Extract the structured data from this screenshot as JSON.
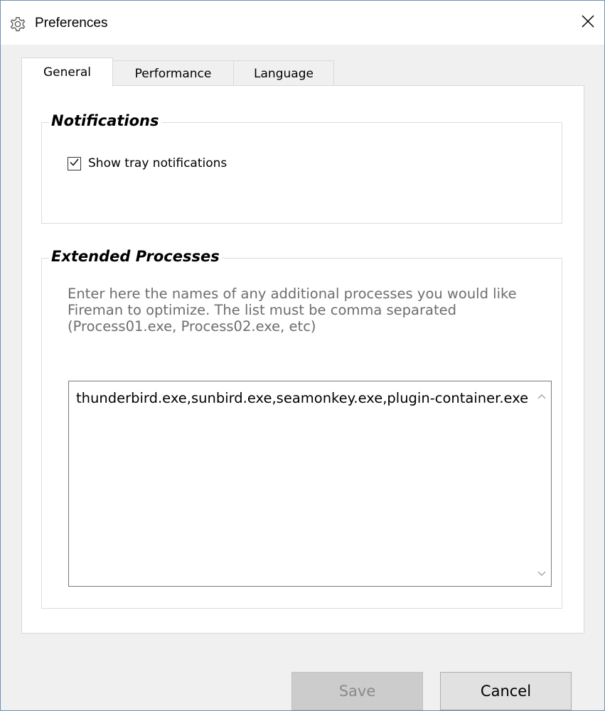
{
  "window": {
    "title": "Preferences",
    "title_icon": "gear-icon",
    "close_icon": "close-icon"
  },
  "tabs": [
    {
      "label": "General",
      "active": true
    },
    {
      "label": "Performance",
      "active": false
    },
    {
      "label": "Language",
      "active": false
    }
  ],
  "notifications": {
    "legend": "Notifications",
    "show_tray": {
      "label": "Show tray notifications",
      "checked": true
    }
  },
  "extended_processes": {
    "legend": "Extended Processes",
    "description": "Enter here the names of any additional processes you would like Fireman to optimize. The list must be comma separated (Process01.exe, Process02.exe, etc)",
    "value": "thunderbird.exe,sunbird.exe,seamonkey.exe,plugin-container.exe"
  },
  "buttons": {
    "save_label": "Save",
    "save_enabled": false,
    "cancel_label": "Cancel"
  },
  "colors": {
    "description_text": "#6d6d6d",
    "disabled_button": "#cccccc",
    "button_face": "#e1e1e1"
  }
}
